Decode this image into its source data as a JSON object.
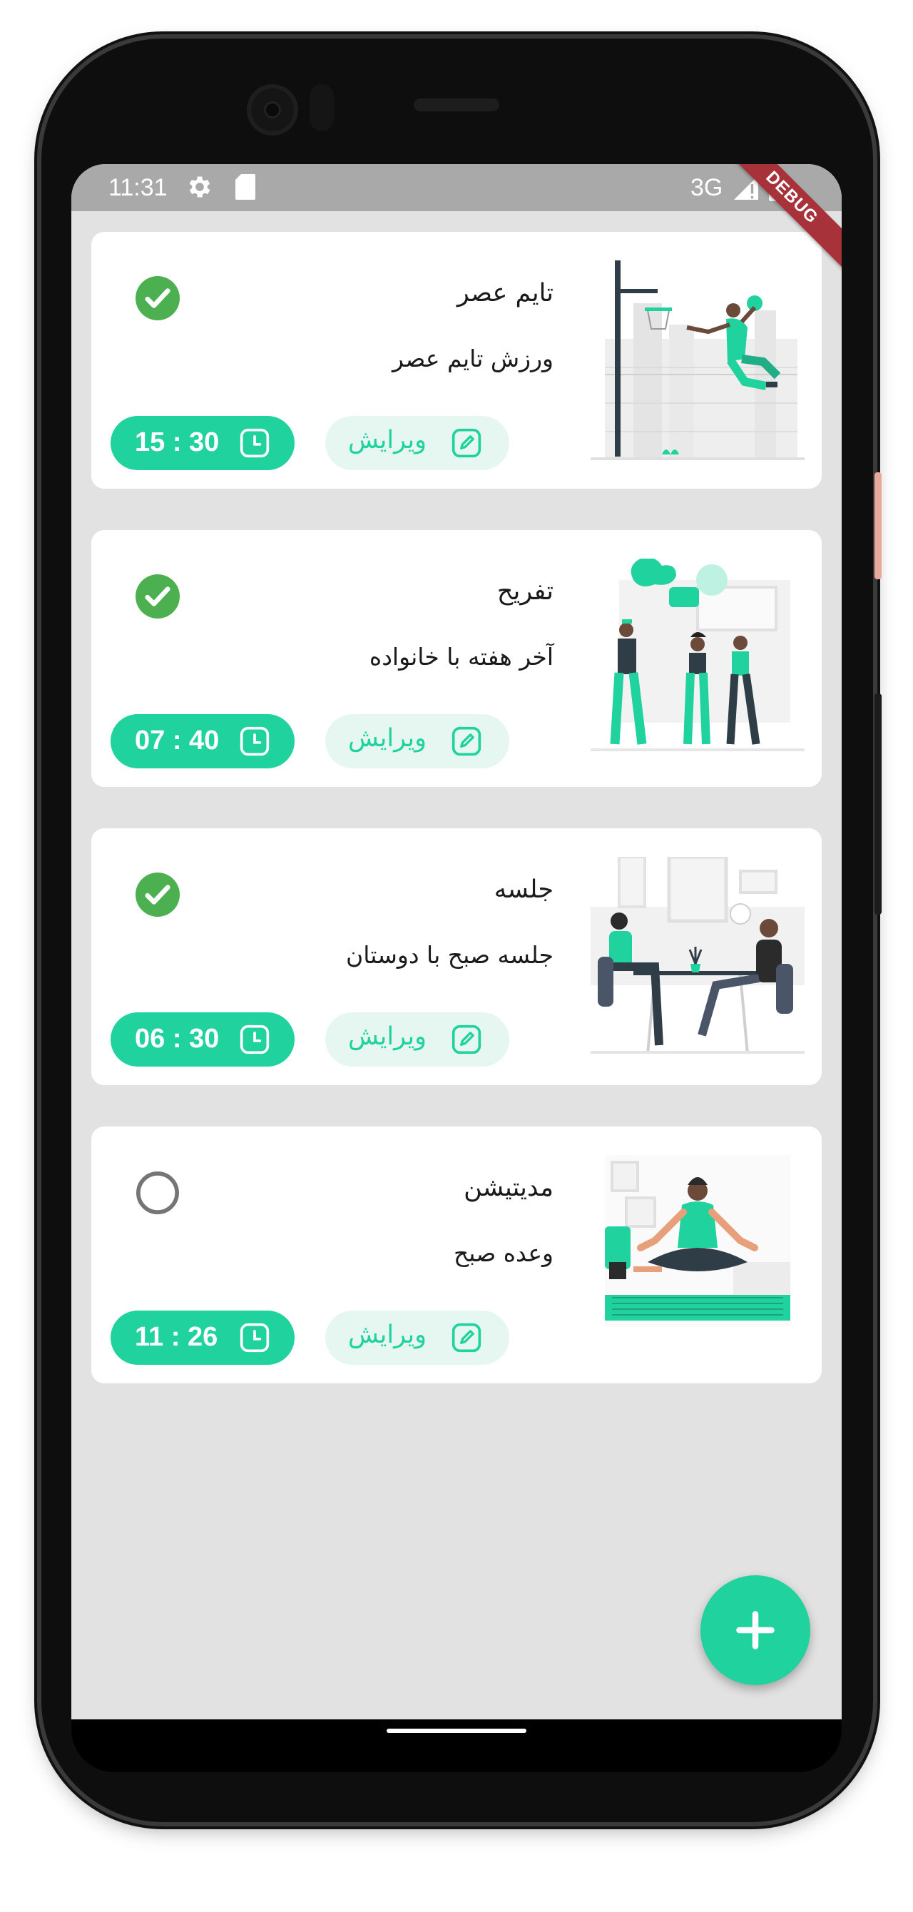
{
  "status_bar": {
    "time": "11:31",
    "network": "3G",
    "icons": [
      "gear-icon",
      "sd-card-icon",
      "signal-icon",
      "battery-icon"
    ]
  },
  "debug_banner": "DEBUG",
  "edit_label": "ویرایش",
  "tasks": [
    {
      "title": "تایم عصر",
      "subtitle": "ورزش تایم عصر",
      "time": "15 : 30",
      "done": true,
      "illustration": "basketball-illustration"
    },
    {
      "title": "تفریح",
      "subtitle": "آخر هفته با خانواده",
      "time": "07 : 40",
      "done": true,
      "illustration": "friends-gathering-illustration"
    },
    {
      "title": "جلسه",
      "subtitle": "جلسه صبح با دوستان",
      "time": "06 : 30",
      "done": true,
      "illustration": "meeting-illustration"
    },
    {
      "title": "مدیتیشن",
      "subtitle": "وعده صبح",
      "time": "11 : 26",
      "done": false,
      "illustration": "meditation-illustration"
    }
  ],
  "colors": {
    "accent": "#20d29e",
    "accent_light": "#e6f7f1",
    "check_green": "#4caf50",
    "background": "#e2e2e2",
    "debug_red": "#a8323a"
  },
  "fab": {
    "icon": "plus-icon"
  }
}
